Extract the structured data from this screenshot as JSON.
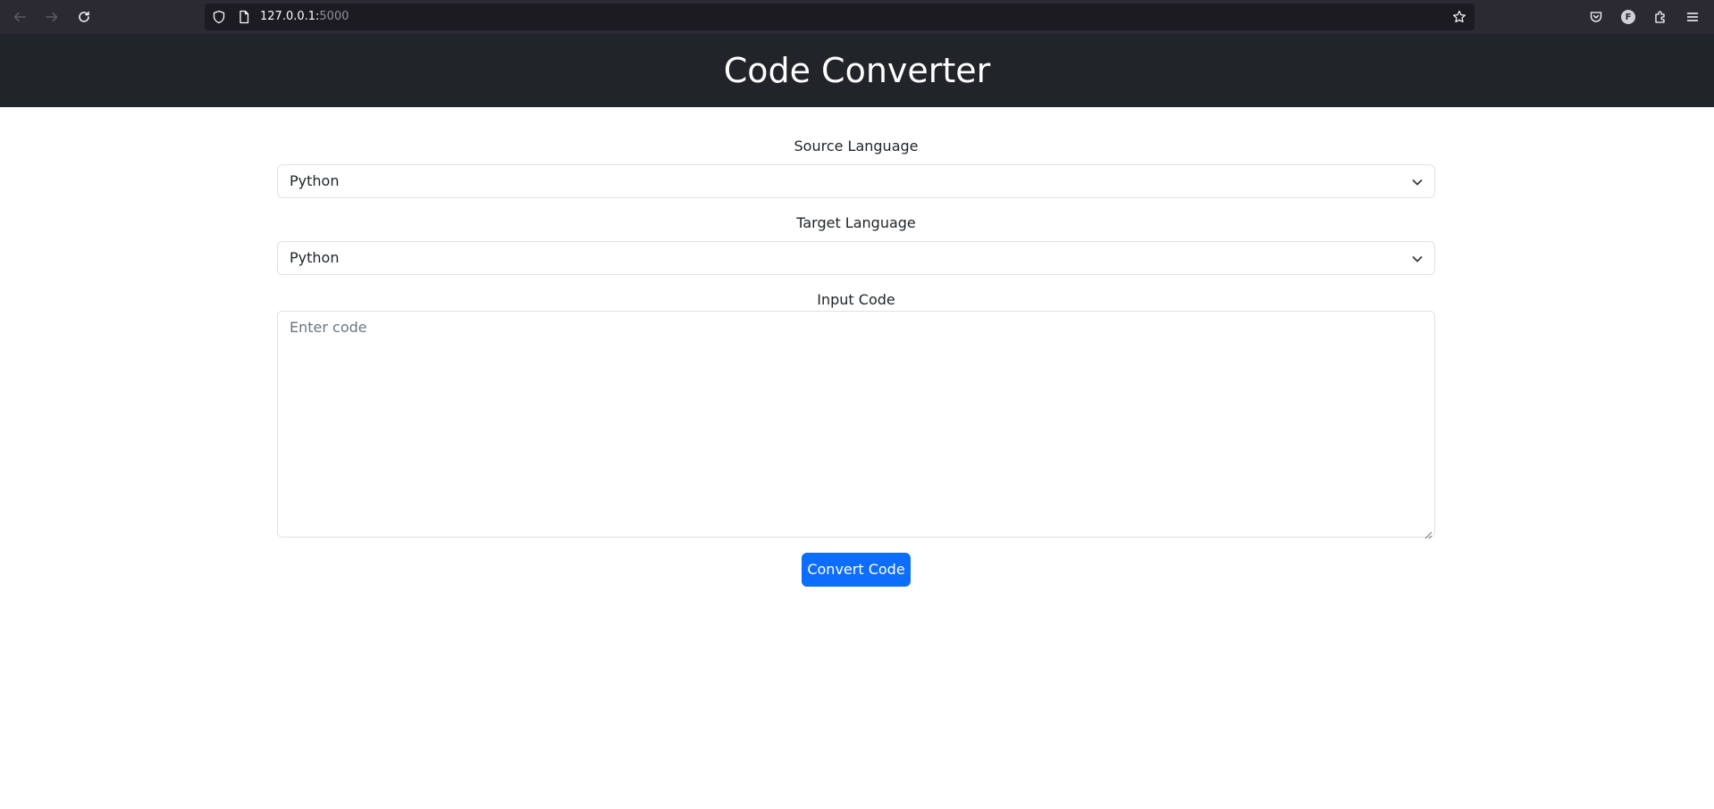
{
  "browser": {
    "url_host": "127.0.0.1:",
    "url_port": "5000",
    "avatar_letter": "F"
  },
  "header": {
    "title": "Code Converter",
    "background": "#212529"
  },
  "form": {
    "source_label": "Source Language",
    "source_value": "Python",
    "target_label": "Target Language",
    "target_value": "Python",
    "input_label": "Input Code",
    "input_placeholder": "Enter code",
    "input_value": "",
    "convert_label": "Convert Code",
    "button_color": "#0d6efd"
  }
}
